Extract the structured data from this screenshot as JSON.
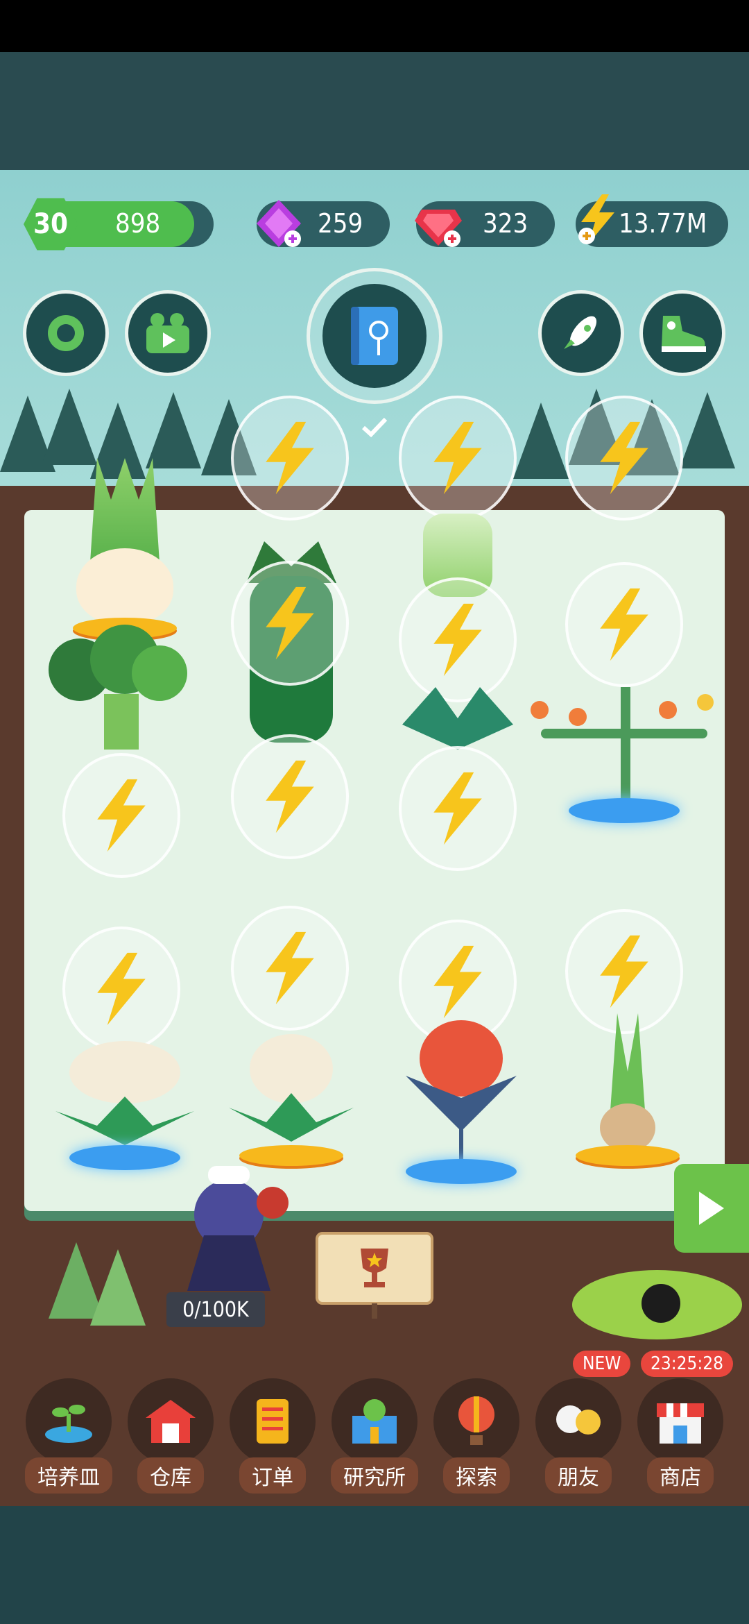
{
  "hud": {
    "level": "30",
    "xp": "898",
    "purple_gems": "259",
    "red_gems": "323",
    "energy": "13.77M"
  },
  "char_counter": "0/100K",
  "nav": {
    "items": [
      {
        "label": "培养皿",
        "icon": "sprout-icon"
      },
      {
        "label": "仓库",
        "icon": "barn-icon"
      },
      {
        "label": "订单",
        "icon": "scroll-icon"
      },
      {
        "label": "研究所",
        "icon": "lab-icon"
      },
      {
        "label": "探索",
        "icon": "balloon-icon"
      },
      {
        "label": "朋友",
        "icon": "friends-icon"
      },
      {
        "label": "商店",
        "icon": "shop-icon"
      }
    ],
    "friends_badge": "NEW",
    "shop_timer": "23:25:28"
  },
  "colors": {
    "xp_bar": "#4fbd4e",
    "pill_bg": "#2e5e63",
    "energy_bubble": "#f7c51c",
    "nav_label_bg": "#7a4631",
    "badge": "#e9463d"
  }
}
